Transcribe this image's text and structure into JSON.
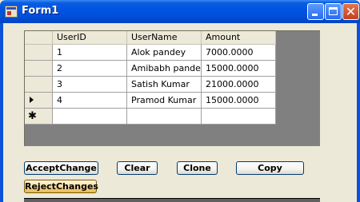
{
  "window": {
    "title": "Form1",
    "icons": [
      "form-icon",
      "minimize-icon",
      "maximize-icon",
      "close-icon"
    ]
  },
  "grid": {
    "columns": [
      "UserID",
      "UserName",
      "Amount"
    ],
    "rows": [
      [
        "1",
        "Alok pandey",
        "7000.0000"
      ],
      [
        "2",
        "Amibabh pandey",
        "15000.0000"
      ],
      [
        "3",
        "Satish Kumar",
        "21000.0000"
      ],
      [
        "4",
        "Pramod Kumar",
        "15000.0000"
      ]
    ],
    "current_row_marker": "►",
    "new_row_marker": "✱"
  },
  "buttons": {
    "accept": "AcceptChange",
    "clear": "Clear",
    "clone": "Clone",
    "copy": "Copy",
    "reject": "RejectChanges"
  },
  "colors": {
    "titlebar": "#0054e3",
    "grid_background": "#808080",
    "form_background": "#ece9d8"
  }
}
